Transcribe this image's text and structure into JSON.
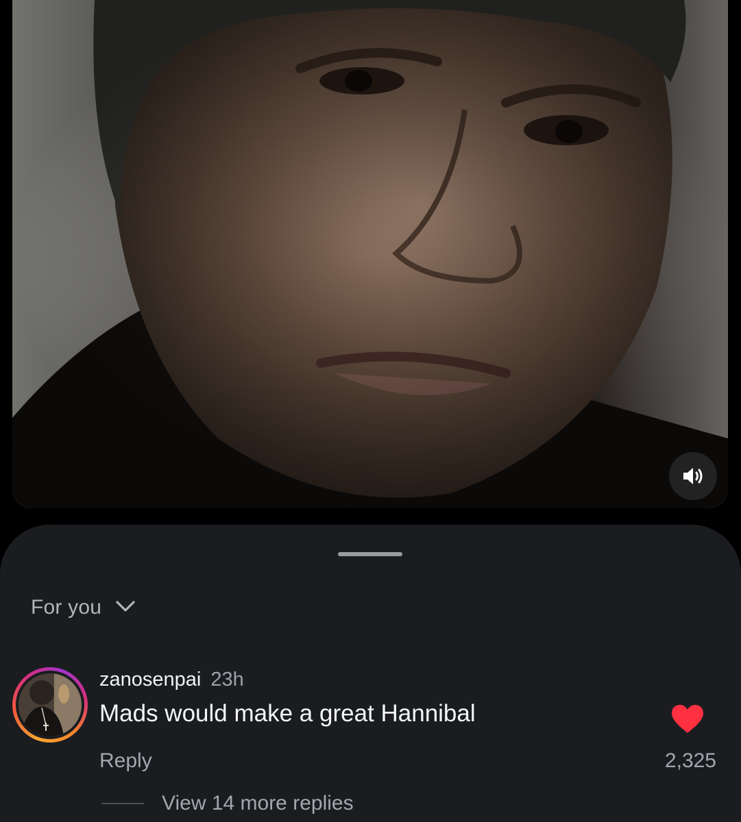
{
  "video": {
    "mute_icon": "speaker-icon"
  },
  "comments_sheet": {
    "filter": {
      "label": "For you",
      "icon": "chevron-down-icon"
    },
    "comment": {
      "username": "zanosenpai",
      "timestamp": "23h",
      "text": "Mads would make a great Hannibal",
      "reply_label": "Reply",
      "like_count": "2,325",
      "liked": true,
      "like_color": "#ff3040",
      "view_replies_label": "View 14 more replies"
    }
  }
}
